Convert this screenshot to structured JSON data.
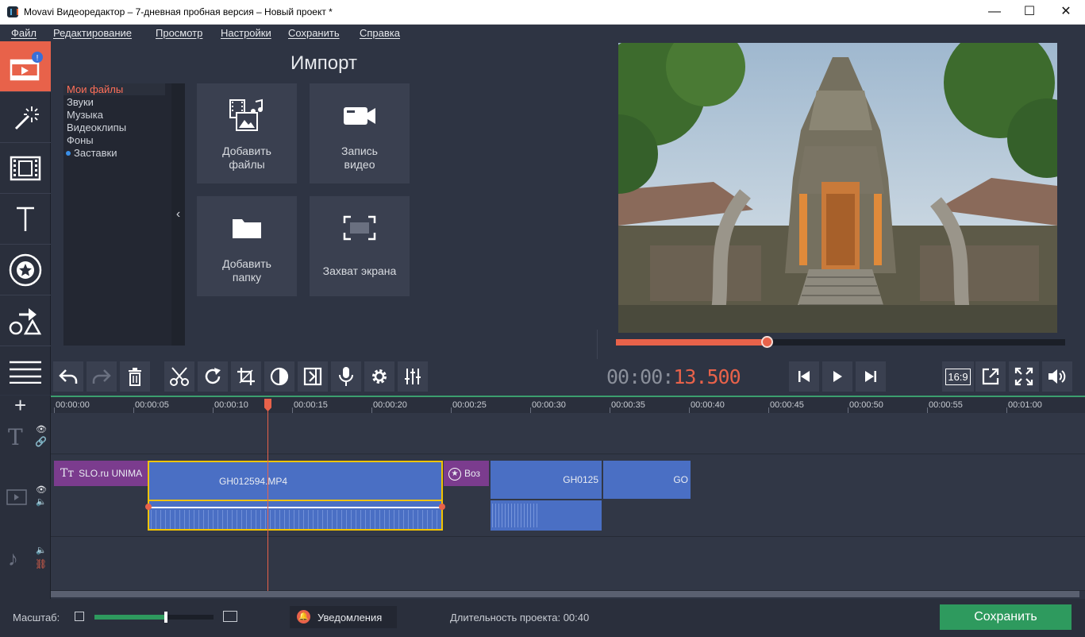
{
  "window": {
    "title": "Movavi Видеоредактор – 7-дневная пробная версия – Новый проект *"
  },
  "menu": [
    "Файл",
    "Редактирование",
    "Просмотр",
    "Настройки",
    "Сохранить",
    "Справка"
  ],
  "left_tools": [
    "import-tool",
    "filters-tool",
    "transitions-tool",
    "titles-tool",
    "stickers-tool",
    "callouts-tool",
    "more-tool"
  ],
  "import": {
    "title": "Импорт",
    "categories": [
      "Мои файлы",
      "Звуки",
      "Музыка",
      "Видеоклипы",
      "Фоны",
      "Заставки"
    ],
    "selected_category": "Мои файлы",
    "tiles": [
      {
        "label_line1": "Добавить",
        "label_line2": "файлы"
      },
      {
        "label_line1": "Запись",
        "label_line2": "видео"
      },
      {
        "label_line1": "Добавить",
        "label_line2": "папку"
      },
      {
        "label_line1": "Захват экрана",
        "label_line2": ""
      }
    ]
  },
  "player": {
    "timecode_prefix": "00:00:",
    "timecode_seconds": "13.500",
    "aspect": "16:9",
    "progress": 0.338
  },
  "timeline": {
    "ticks": [
      "00:00:00",
      "00:00:05",
      "00:00:10",
      "00:00:15",
      "00:00:20",
      "00:00:25",
      "00:00:30",
      "00:00:35",
      "00:00:40",
      "00:00:45",
      "00:00:50",
      "00:00:55",
      "00:01:00"
    ],
    "playhead_time": "00:00:13.500",
    "clips": [
      {
        "label": "SLO.ru UNIMA",
        "kind": "title"
      },
      {
        "label": "GH012594.MP4",
        "kind": "video"
      },
      {
        "label": "Воз",
        "kind": "transition"
      },
      {
        "label": "GH0125",
        "kind": "video"
      },
      {
        "label": "GO",
        "kind": "video"
      }
    ]
  },
  "bottom": {
    "zoom_label": "Масштаб:",
    "zoom_value": 0.6,
    "notifications": "Уведомления",
    "duration_label": "Длительность проекта:",
    "duration_value": "00:40",
    "save": "Сохранить"
  },
  "colors": {
    "accent": "#e8624a",
    "save": "#2e9a5e",
    "clip": "#4a6fc4",
    "title_clip": "#7b3c8e"
  }
}
